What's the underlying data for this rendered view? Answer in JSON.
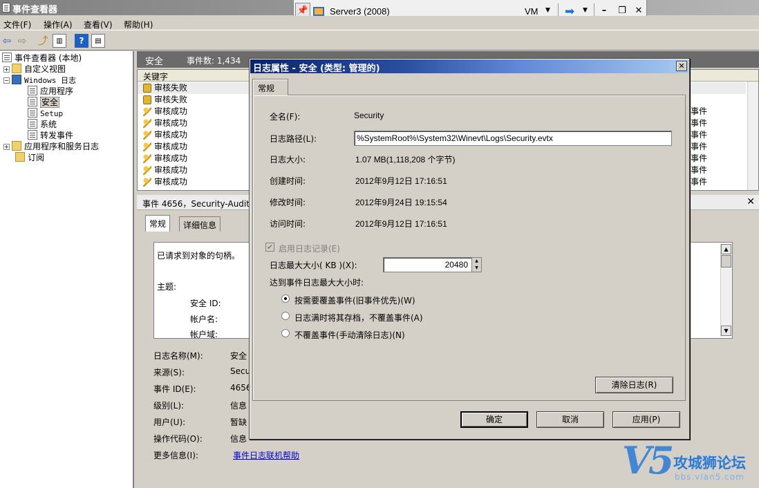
{
  "window": {
    "title": "事件查看器"
  },
  "vm_bar": {
    "server_name": "Server3 (2008)",
    "vm_label": "VM"
  },
  "menu": [
    "文件(F)",
    "操作(A)",
    "查看(V)",
    "帮助(H)"
  ],
  "tree": {
    "root": "事件查看器 (本地)",
    "custom_views": "自定义视图",
    "windows_logs": "Windows 日志",
    "app": "应用程序",
    "security": "安全",
    "setup": "Setup",
    "system": "系统",
    "forwarded": "转发事件",
    "app_services": "应用程序和服务日志",
    "subscriptions": "订阅"
  },
  "log_header": {
    "title": "安全",
    "count": "事件数: 1,434"
  },
  "event_list": {
    "column": "关键字",
    "rows": [
      {
        "keyword": "审核失败",
        "type": "fail",
        "tail": ""
      },
      {
        "keyword": "审核失败",
        "type": "fail",
        "tail": ""
      },
      {
        "keyword": "审核成功",
        "type": "success",
        "tail": "事件"
      },
      {
        "keyword": "审核成功",
        "type": "success",
        "tail": "事件"
      },
      {
        "keyword": "审核成功",
        "type": "success",
        "tail": "事件"
      },
      {
        "keyword": "审核成功",
        "type": "success",
        "tail": "事件"
      },
      {
        "keyword": "审核成功",
        "type": "success",
        "tail": "事件"
      },
      {
        "keyword": "审核成功",
        "type": "success",
        "tail": "事件"
      },
      {
        "keyword": "审核成功",
        "type": "success",
        "tail": "事件"
      }
    ]
  },
  "detail": {
    "header": "事件 4656，Security-Auditi",
    "tab_general": "常规",
    "tab_details": "详细信息",
    "message_line1": "已请求到对象的句柄。",
    "subject_label": "主题:",
    "security_id_label": "安全 ID:",
    "account_name_label": "帐户名:",
    "account_domain_label": "帐户域:",
    "props": [
      {
        "label": "日志名称(M):",
        "value": "安全"
      },
      {
        "label": "来源(S):",
        "value": "Secu"
      },
      {
        "label": "事件 ID(E):",
        "value": "4656"
      },
      {
        "label": "级别(L):",
        "value": "信息"
      },
      {
        "label": "用户(U):",
        "value": "暂缺"
      },
      {
        "label": "操作代码(O):",
        "value": "信息"
      }
    ],
    "more_info_label": "更多信息(I):",
    "more_info_link": "事件日志联机帮助"
  },
  "dialog": {
    "title": "日志属性 - 安全 (类型: 管理的)",
    "tab": "常规",
    "full_name_label": "全名(F):",
    "full_name": "Security",
    "log_path_label": "日志路径(L):",
    "log_path": "%SystemRoot%\\System32\\Winevt\\Logs\\Security.evtx",
    "log_size_label": "日志大小:",
    "log_size": "1.07 MB(1,118,208 个字节)",
    "created_label": "创建时间:",
    "created": "2012年9月12日 17:16:51",
    "modified_label": "修改时间:",
    "modified": "2012年9月24日 19:15:54",
    "accessed_label": "访问时间:",
    "accessed": "2012年9月12日 17:16:51",
    "enable_logging": "启用日志记录(E)",
    "max_size_label": "日志最大大小( KB )(X):",
    "max_size": "20480",
    "when_full_label": "达到事件日志最大大小时:",
    "options": [
      "按需要覆盖事件(旧事件优先)(W)",
      "日志满时将其存档，不覆盖事件(A)",
      "不覆盖事件(手动清除日志)(N)"
    ],
    "selected_option": 0,
    "clear_button": "清除日志(R)",
    "ok_button": "确定",
    "cancel_button": "取消",
    "apply_button": "应用(P)"
  },
  "watermark": {
    "logo": "V5",
    "text": "攻城狮论坛",
    "url": "bbs.vlan5.com"
  }
}
